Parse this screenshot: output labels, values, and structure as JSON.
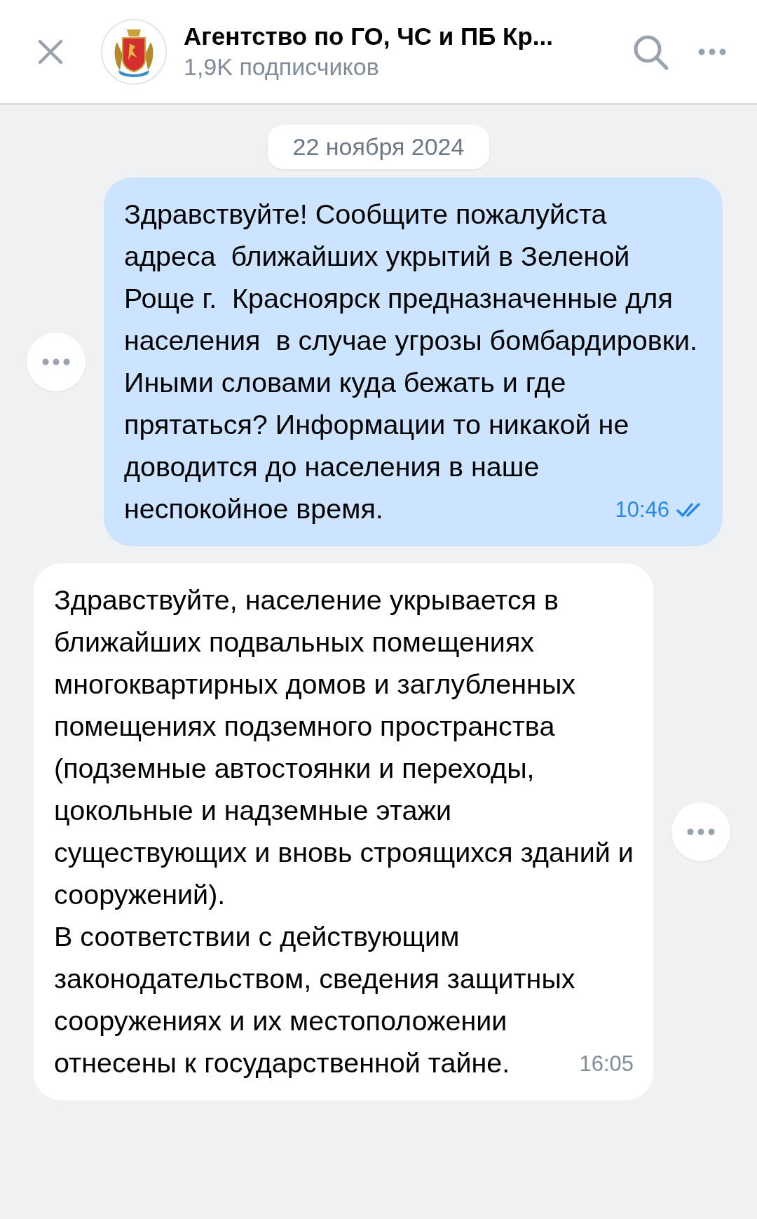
{
  "header": {
    "title": "Агентство по ГО, ЧС и ПБ Кр...",
    "subtitle": "1,9K подписчиков"
  },
  "date": "22 ноября 2024",
  "messages": [
    {
      "kind": "outgoing",
      "text": "Здравствуйте! Сообщите пожалуйста адреса  ближайших укрытий в Зеленой Роще г.  Красноярск предназначенные для населения  в случае угрозы бомбардировки.  Иными словами куда бежать и где прятаться? Информации то никакой не доводится до населения в наше неспокойное время.",
      "time": "10:46",
      "read": true
    },
    {
      "kind": "incoming",
      "text": "Здравствуйте, население укрывается в ближайших подвальных помещениях многоквартирных домов и заглубленных помещениях подземного пространства (подземные автостоянки и переходы, цокольные и надземные этажи существующих и вновь строящихся зданий и сооружений).\nВ соответствии с действующим законодательством, сведения защитных сооружениях и их местоположении отнесены к государственной тайне.",
      "time": "16:05"
    }
  ]
}
